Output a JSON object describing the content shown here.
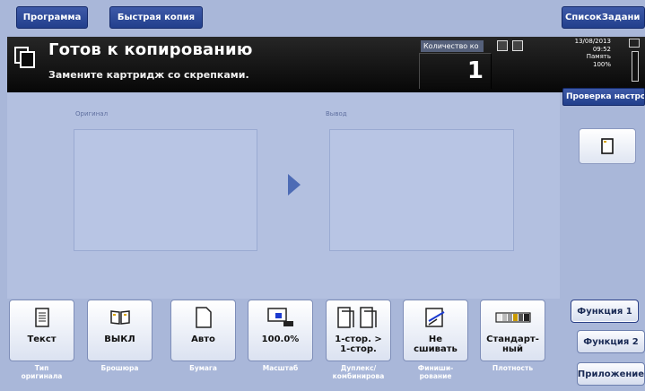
{
  "top_tabs": {
    "program": "Программа",
    "quick_copy": "Быстрая копия",
    "job_list": "СписокЗадани"
  },
  "status": {
    "title": "Готов к копированию",
    "message": "Замените картридж со скрепками.",
    "quantity_label": "Количество ко",
    "quantity_value": "1",
    "date": "13/08/2013",
    "time": "09:52",
    "memory_label": "Память",
    "memory_value": "100%"
  },
  "right_panel": {
    "check_button": "Проверка настро",
    "function1": "Функция 1",
    "function2": "Функция 2",
    "application": "Приложение"
  },
  "main": {
    "original_label": "Оригинал",
    "output_label": "Вывод"
  },
  "functions": [
    {
      "value": "Текст",
      "caption": "Тип\nоригинала",
      "icon": "text-document-icon"
    },
    {
      "value": "ВЫКЛ",
      "caption": "Брошюра",
      "icon": "booklet-icon"
    },
    {
      "value": "Авто",
      "caption": "Бумага",
      "icon": "paper-icon"
    },
    {
      "value": "100.0%",
      "caption": "Масштаб",
      "icon": "zoom-icon"
    },
    {
      "value": "1-стор. >\n1-стор.",
      "caption": "Дуплекс/\nкомбинирова",
      "icon": "duplex-icon"
    },
    {
      "value": "Не\nсшивать",
      "caption": "Финиши-\nрование",
      "icon": "finishing-icon"
    },
    {
      "value": "Стандарт-\nный",
      "caption": "Плотность",
      "icon": "density-icon"
    }
  ]
}
